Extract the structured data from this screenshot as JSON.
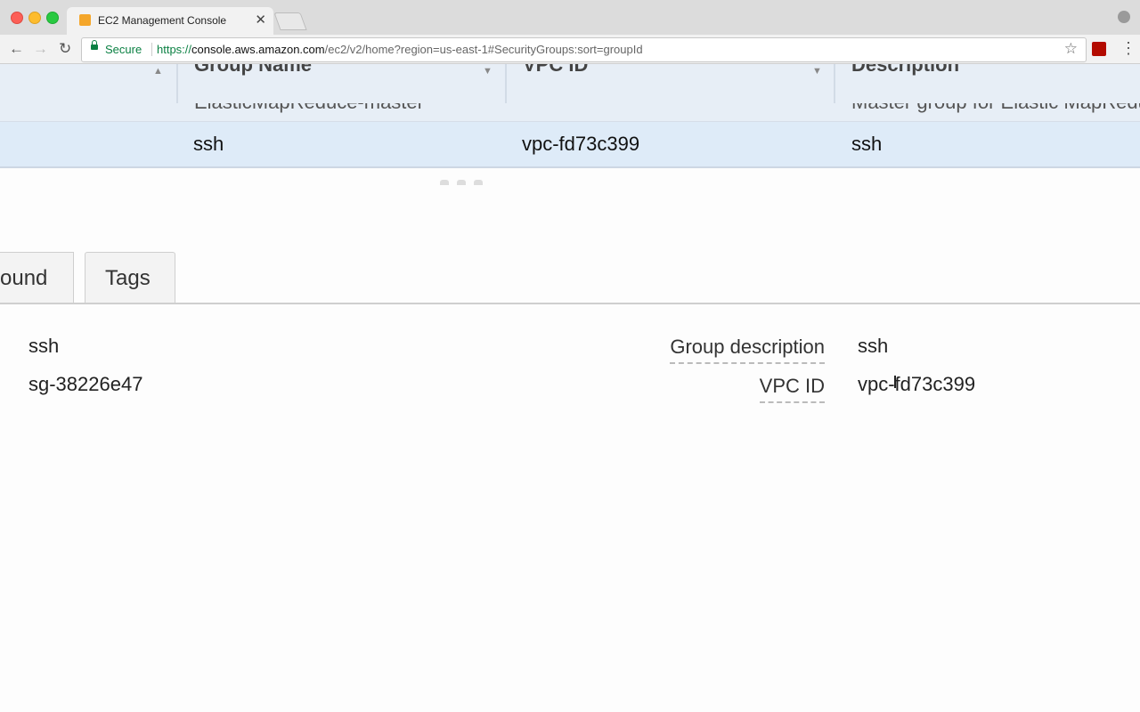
{
  "browser": {
    "tab_title": "EC2 Management Console",
    "tab_close": "✕",
    "secure_label": "Secure",
    "url_scheme": "https://",
    "url_host": "console.aws.amazon.com",
    "url_path": "/ec2/v2/home?region=us-east-1#SecurityGroups:sort=groupId",
    "nav_back": "←",
    "nav_forward": "→",
    "nav_reload": "↻",
    "star": "☆",
    "menu": "⋮"
  },
  "grid": {
    "columns": [
      {
        "label": "Group Name"
      },
      {
        "label": "VPC ID"
      },
      {
        "label": "Description"
      }
    ],
    "partial_row": {
      "group_name": "ElasticMapReduce-master",
      "vpc_id": "",
      "description": "Master group for Elastic MapReduce"
    },
    "selected_row": {
      "group_name": "ssh",
      "vpc_id": "vpc-fd73c399",
      "description": "ssh"
    }
  },
  "detail_tabs": {
    "partial_tab": "ound",
    "tags": "Tags"
  },
  "details": {
    "group_name_value": "ssh",
    "group_id_value": "sg-38226e47",
    "group_description_label": "Group description",
    "group_description_value": "ssh",
    "vpc_id_label": "VPC ID",
    "vpc_id_value": "vpc-fd73c399"
  },
  "colors": {
    "grid_header_bg": "#e7eef6",
    "selected_row_bg": "#deebf8",
    "secure_green": "#0b8043"
  }
}
